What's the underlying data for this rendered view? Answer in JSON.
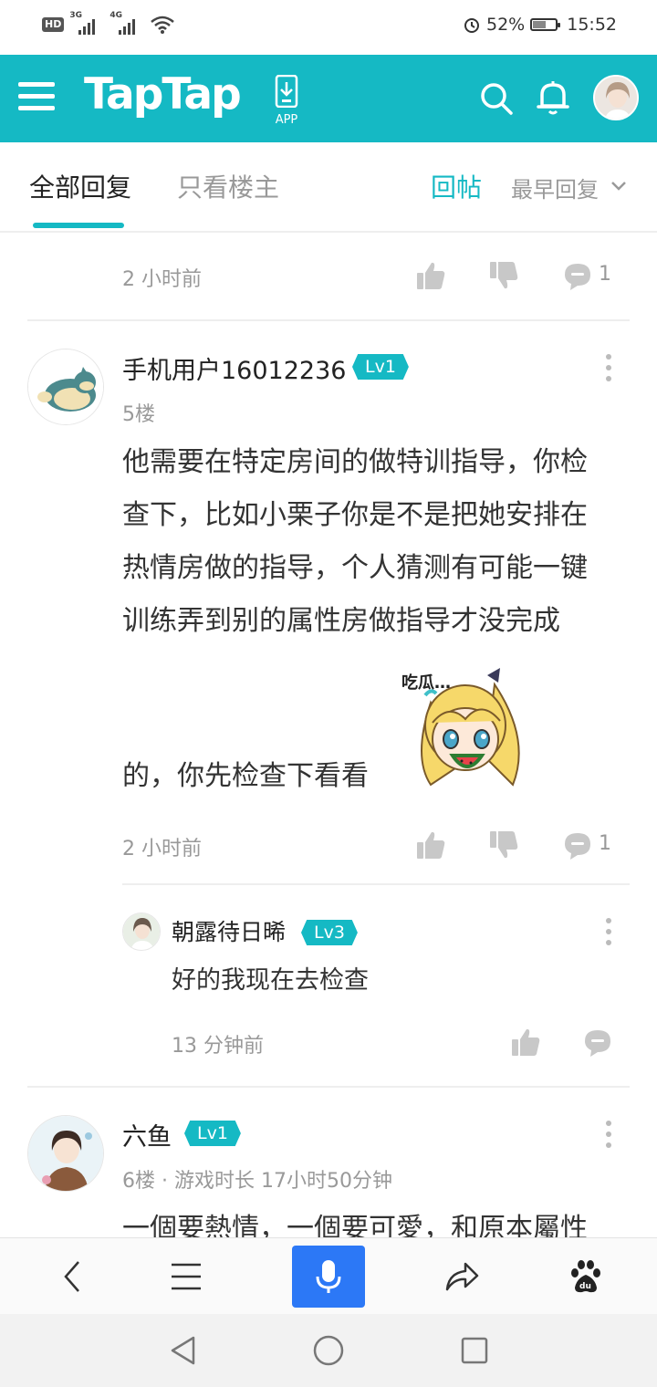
{
  "status_bar": {
    "hd": "HD",
    "net1": "3G",
    "net2": "4G",
    "battery_pct": "52%",
    "time": "15:52"
  },
  "header": {
    "logo": "TapTap",
    "app_label": "APP",
    "brand_color": "#15b9c4"
  },
  "tabs": {
    "all_replies": "全部回复",
    "owner_only": "只看楼主",
    "reply_post": "回帖",
    "sort": "最早回复"
  },
  "prev_item": {
    "time": "2 小时前",
    "comment_count": "1"
  },
  "comments": [
    {
      "username": "手机用户16012236",
      "level": "Lv1",
      "floor": "5楼",
      "body_lines": [
        "他需要在特定房间的做特训指导，你检",
        "查下，比如小栗子你是不是把她安排在",
        "热情房做的指导，个人猜测有可能一键",
        "训练弄到别的属性房做指导才没完成"
      ],
      "body_tail": "的，你先检查下看看",
      "sticker_text": "吃瓜…",
      "time": "2 小时前",
      "comment_count": "1",
      "reply": {
        "username": "朝露待日晞",
        "level": "Lv3",
        "text": "好的我现在去检查",
        "time": "13 分钟前"
      }
    },
    {
      "username": "六鱼",
      "level": "Lv1",
      "floor": "6楼 · 游戏时长 17小时50分钟",
      "body_partial": "一個要熱情，一個要可愛，和原本屬性"
    }
  ]
}
